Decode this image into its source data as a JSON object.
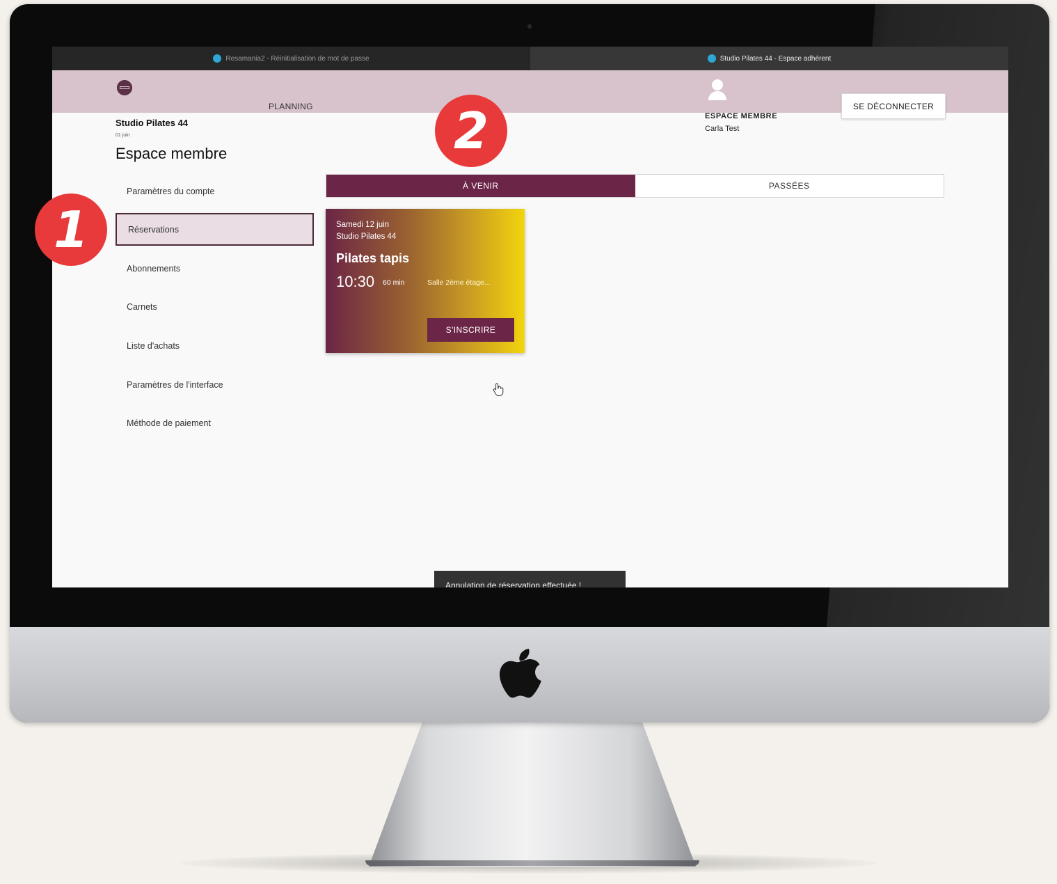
{
  "browser": {
    "tabs": [
      {
        "title": "Resamania2 - Réinitialisation de mot de passe",
        "active": false
      },
      {
        "title": "Studio Pilates 44 - Espace adhérent",
        "active": true
      }
    ]
  },
  "header": {
    "nav_planning": "PLANNING",
    "member_label": "ESPACE MEMBRE",
    "member_name": "Carla Test",
    "logout_label": "SE DÉCONNECTER"
  },
  "sidebar": {
    "studio_name": "Studio Pilates 44",
    "date": "01 juin",
    "page_title": "Espace membre",
    "items": [
      {
        "label": "Paramètres du compte",
        "selected": false
      },
      {
        "label": "Réservations",
        "selected": true
      },
      {
        "label": "Abonnements",
        "selected": false
      },
      {
        "label": "Carnets",
        "selected": false
      },
      {
        "label": "Liste d'achats",
        "selected": false
      },
      {
        "label": "Paramètres de l'interface",
        "selected": false
      },
      {
        "label": "Méthode de paiement",
        "selected": false
      }
    ]
  },
  "reservations": {
    "tabs": [
      {
        "label": "À VENIR",
        "active": true
      },
      {
        "label": "PASSÉES",
        "active": false
      }
    ],
    "card": {
      "date": "Samedi 12 juin",
      "studio": "Studio Pilates 44",
      "title": "Pilates tapis",
      "time": "10:30",
      "duration": "60 min",
      "room": "Salle 2ème étage...",
      "button_label": "S'INSCRIRE"
    }
  },
  "toast": {
    "message": "Annulation de réservation effectuée !"
  },
  "annotations": {
    "badge_1": "1",
    "badge_2": "2"
  },
  "colors": {
    "accent": "#6b2546",
    "header_bg": "#d8c3cc",
    "badge": "#e83a3a",
    "card_gradient_end": "#f2d40d"
  }
}
